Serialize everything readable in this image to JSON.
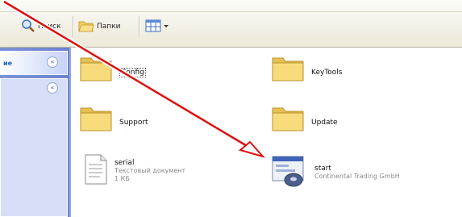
{
  "toolbar": {
    "search_label": "Поиск",
    "folders_label": "Папки"
  },
  "left_pane": {
    "panel1_title": "ие"
  },
  "files": {
    "config": "Config",
    "keytools": "KeyTools",
    "support": "Support",
    "update": "Update",
    "serial": {
      "name": "serial",
      "type": "Текстовый документ",
      "size": "1 КБ"
    },
    "start": {
      "name": "start",
      "publisher": "Continental Trading GmbH"
    }
  },
  "colors": {
    "arrow": "#e01010",
    "folder": "#f5d46a",
    "sidebar": "#7c93d8"
  },
  "icons": [
    "search-icon",
    "folders-icon",
    "views-icon",
    "folder-icon",
    "text-document-icon",
    "setup-icon"
  ]
}
